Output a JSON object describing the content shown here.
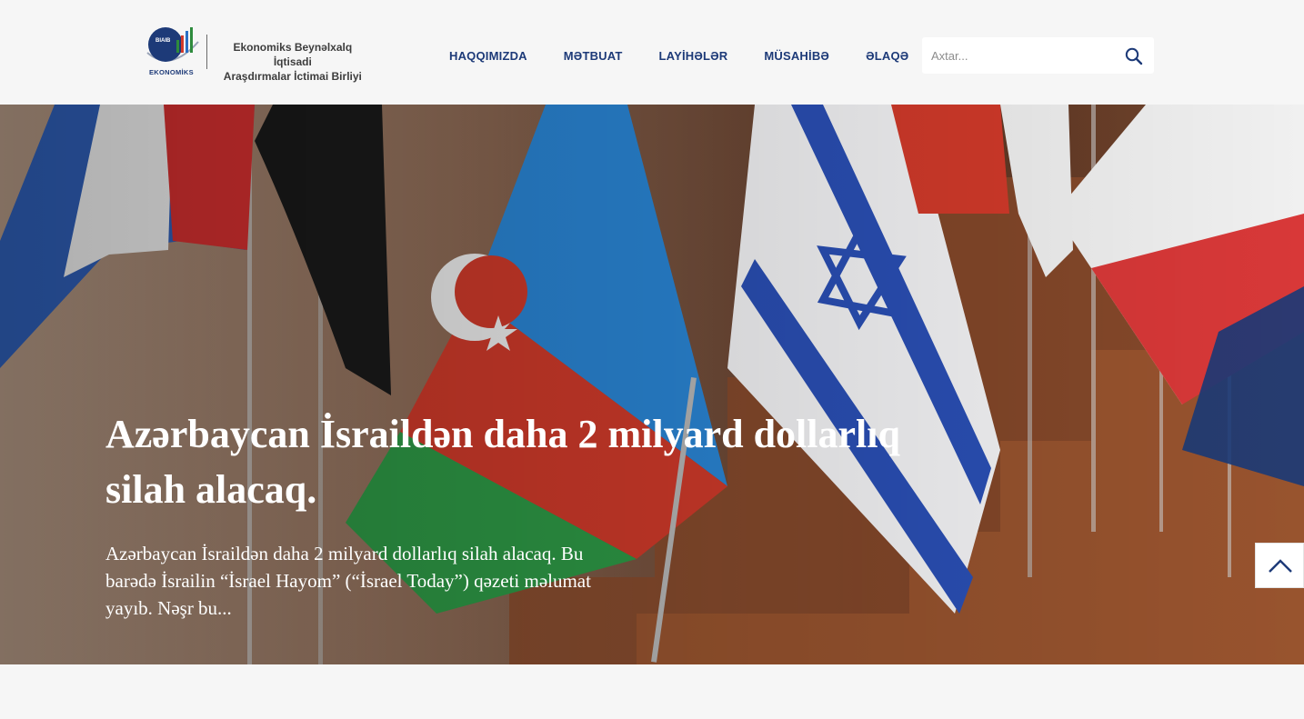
{
  "header": {
    "logo": {
      "mark_text": "BIAIB",
      "caption": "EKONOMİKS",
      "line1": "Ekonomiks Beynəlxalq İqtisadi",
      "line2": "Araşdırmalar İctimai Birliyi"
    },
    "nav": [
      {
        "label": "HAQQIMIZDA"
      },
      {
        "label": "MƏTBUAT"
      },
      {
        "label": "LAYİHƏLƏR"
      },
      {
        "label": "MÜSAHİBƏ"
      },
      {
        "label": "ƏLAQƏ"
      }
    ],
    "search": {
      "placeholder": "Axtar...",
      "icon": "search-icon"
    }
  },
  "hero": {
    "title": "Azərbaycan İsraildən daha 2 milyard dollarlıq silah alacaq.",
    "excerpt": "Azərbaycan İsraildən daha 2 milyard dollarlıq silah alacaq. Bu barədə İsrailin “İsrael Hayom” (“İsrael Today”) qəzeti məlumat yayıb. Nəşr bu..."
  },
  "back_to_top": {
    "icon": "chevron-up-icon"
  },
  "colors": {
    "nav_text": "#1d3a78",
    "page_bg": "#f6f6f6",
    "hero_text": "#ffffff"
  }
}
